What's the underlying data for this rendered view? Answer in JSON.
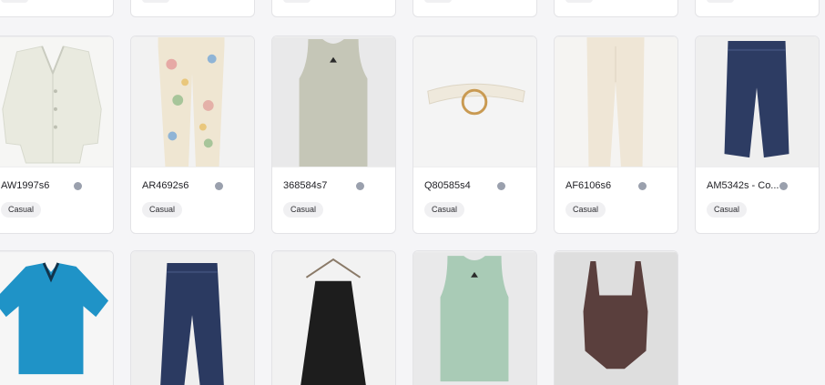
{
  "colors": {
    "status_dot": "#9aa0ad",
    "tag_bg": "#f0f0f2",
    "card_border": "#e3e3e6"
  },
  "row2": [
    {
      "code": "AW1997s6",
      "tag": "Casual",
      "image": "cardigan-white"
    },
    {
      "code": "AR4692s6",
      "tag": "Casual",
      "image": "floral-pants"
    },
    {
      "code": "368584s7",
      "tag": "Casual",
      "image": "sage-tank-top"
    },
    {
      "code": "Q80585s4",
      "tag": "Casual",
      "image": "white-belt"
    },
    {
      "code": "AF6106s6",
      "tag": "Casual",
      "image": "cream-jeans"
    },
    {
      "code": "AM5342s - Co...",
      "tag": "Casual",
      "image": "dark-denim-jeans"
    }
  ],
  "row3": [
    {
      "image": "blue-polo-shirt"
    },
    {
      "image": "dark-denim-jeans"
    },
    {
      "image": "black-slip-dress"
    },
    {
      "image": "mint-tank-top"
    },
    {
      "image": "brown-bodysuit"
    }
  ]
}
